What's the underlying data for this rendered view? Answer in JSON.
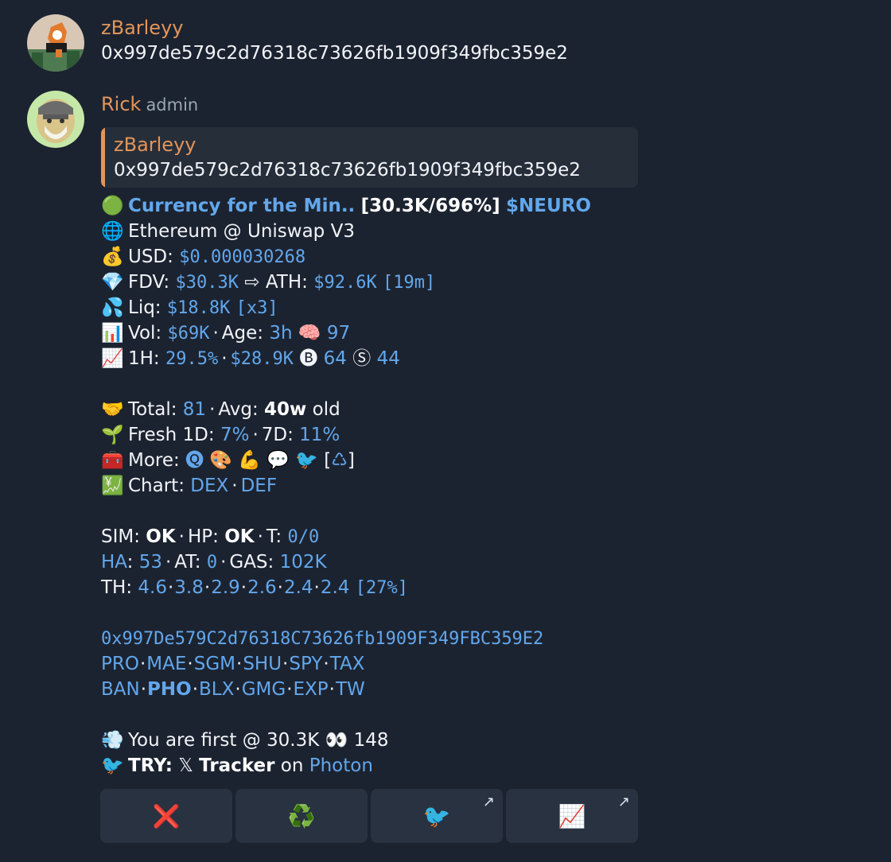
{
  "msg1": {
    "author": "zBarleyy",
    "text": "0x997de579c2d76318c73626fb1909f349fbc359e2"
  },
  "msg2": {
    "author": "Rick",
    "role": "admin",
    "reply": {
      "author": "zBarleyy",
      "text": "0x997de579c2d76318c73626fb1909f349fbc359e2"
    },
    "header": {
      "icon": "🟢",
      "name": "Currency for the Min..",
      "stats": "[30.3K/696%]",
      "ticker": "$NEURO"
    },
    "chain": {
      "icon": "🌐",
      "text": "Ethereum @ Uniswap V3"
    },
    "usd": {
      "icon": "💰",
      "label": "USD: ",
      "value": "$0.000030268"
    },
    "fdv": {
      "icon": "💎",
      "label": "FDV: ",
      "value": "$30.3K",
      "arrow": " ⇨ ",
      "ath_label": "ATH: ",
      "ath_value": "$92.6K",
      "ath_time": "[19m]"
    },
    "liq": {
      "icon": "💦",
      "label": "Liq: ",
      "value": "$18.8K",
      "mult": "[x3]"
    },
    "vol": {
      "icon": "📊",
      "label": "Vol: ",
      "value": "$69K",
      "age_label": "Age: ",
      "age_value": "3h",
      "brain": "🧠",
      "brain_value": "97"
    },
    "h1": {
      "icon": "📈",
      "label": "1H: ",
      "pct": "29.5%",
      "vol": "$28.9K",
      "b_icon": "🅑",
      "b_value": "64",
      "s_icon": "Ⓢ",
      "s_value": "44"
    },
    "total": {
      "icon": "🤝",
      "label": "Total: ",
      "value": "81",
      "avg_label": "Avg: ",
      "avg_value": "40w",
      "avg_suffix": " old"
    },
    "fresh": {
      "icon": "🌱",
      "label": "Fresh 1D: ",
      "d1": "7%",
      "d7_label": "7D: ",
      "d7": "11%"
    },
    "more": {
      "icon": "🧰",
      "label": "More: ",
      "items": [
        "🅠",
        "🎨",
        "💪",
        "💬",
        "🐦"
      ],
      "bracket_open": "[",
      "recycle": "♺",
      "bracket_close": "]"
    },
    "chart": {
      "icon": "💹",
      "label": "Chart: ",
      "dex": "DEX",
      "def": "DEF"
    },
    "sim": {
      "sim_label": "SIM: ",
      "sim": "OK",
      "hp_label": "HP: ",
      "hp": "OK",
      "t_label": "T: ",
      "t": "0/0"
    },
    "ha": {
      "ha_label": "HA",
      "ha": "53",
      "at_label": "AT: ",
      "at": "0",
      "gas_label": "GAS: ",
      "gas": "102K"
    },
    "th": {
      "label": "TH: ",
      "values": [
        "4.6",
        "3.8",
        "2.9",
        "2.6",
        "2.4",
        "2.4"
      ],
      "pct": "[27%]"
    },
    "address": "0x997De579C2d76318C73626fb1909F349FBC359E2",
    "links1": [
      "PRO",
      "MAE",
      "SGM",
      "SHU",
      "SPY",
      "TAX"
    ],
    "links2": [
      "BAN",
      "PHO",
      "BLX",
      "GMG",
      "EXP",
      "TW"
    ],
    "first": {
      "icon": "💨",
      "text": "You are first @ 30.3K ",
      "eyes": "👀",
      "count": " 148"
    },
    "try": {
      "icon": "🐦",
      "label": "TRY:",
      "x": " 𝕏 ",
      "tracker": "Tracker",
      "on": " on ",
      "photon": "Photon"
    },
    "buttons": [
      {
        "icon": "❌"
      },
      {
        "icon": "♻️"
      },
      {
        "icon": "🐦",
        "arrow": "↗"
      },
      {
        "icon": "📈",
        "arrow": "↗"
      }
    ]
  }
}
